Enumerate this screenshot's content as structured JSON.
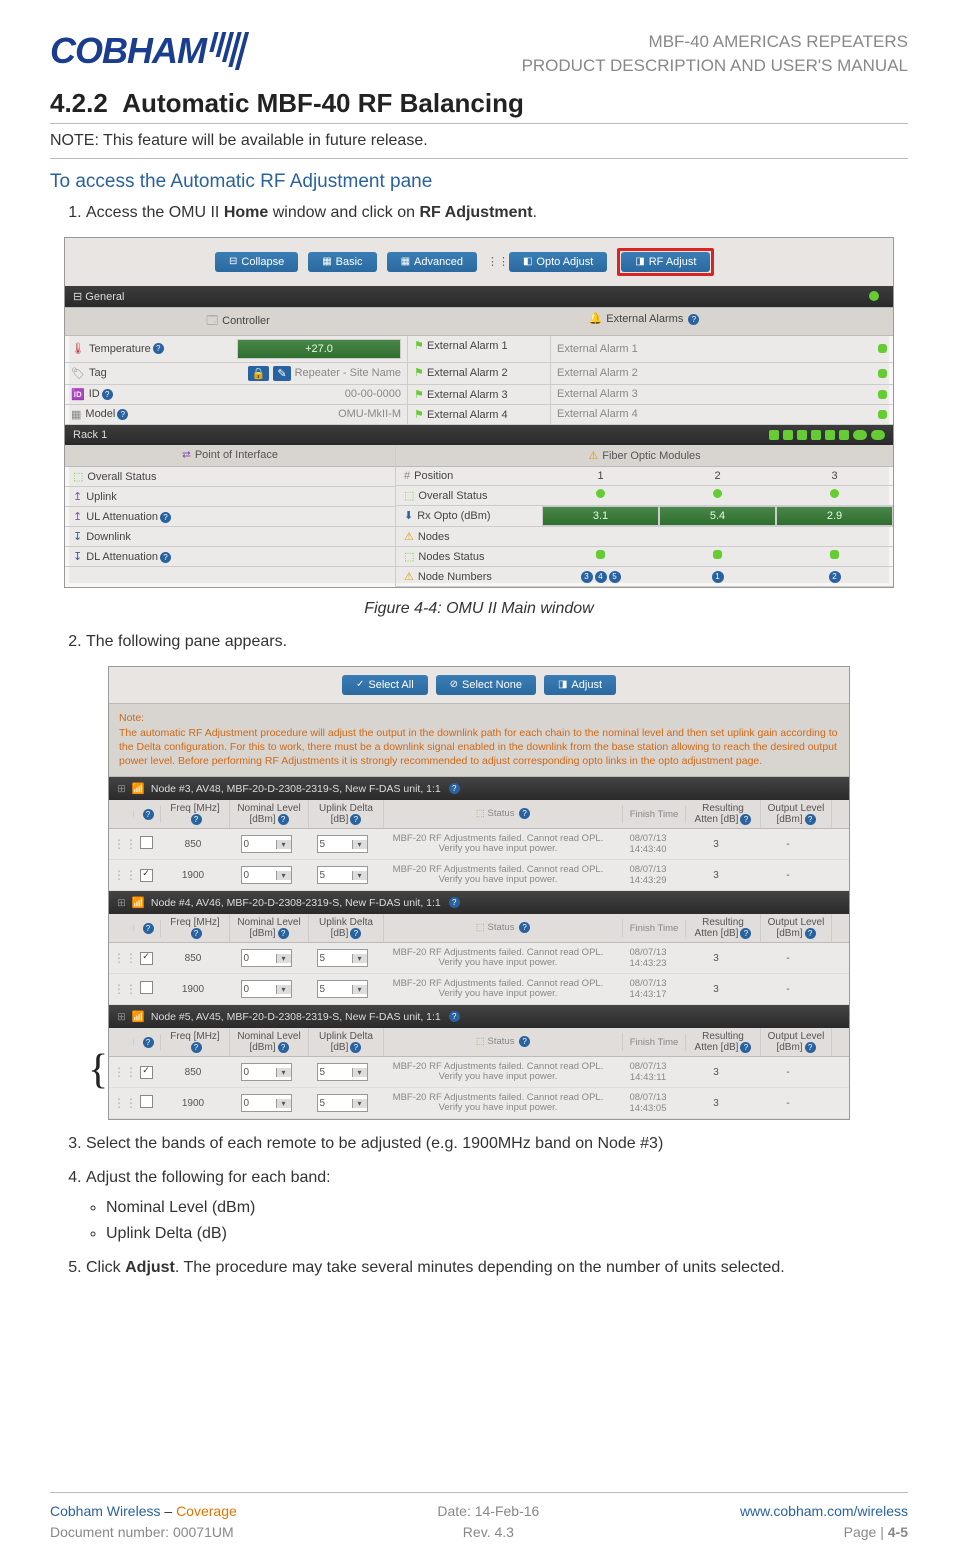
{
  "header": {
    "logo_text": "COBHAM",
    "title_line1": "MBF-40 AMERICAS REPEATERS",
    "title_line2": "PRODUCT DESCRIPTION AND USER'S MANUAL"
  },
  "section": {
    "number": "4.2.2",
    "title": "Automatic MBF-40 RF Balancing",
    "note": "NOTE: This feature will be available in future release.",
    "subtitle": "To access the Automatic RF Adjustment pane",
    "step1_pre": "Access the OMU II ",
    "step1_home": "Home",
    "step1_mid": " window and click on ",
    "step1_rf": "RF Adjustment",
    "step1_end": ".",
    "caption1": "Figure 4-4: OMU II Main window",
    "step2": "The following pane appears.",
    "step3": "Select the bands of each remote to be adjusted (e.g. 1900MHz band on Node #3)",
    "step4": "Adjust the following for each band:",
    "bullets": {
      "b1": "Nominal Level (dBm)",
      "b2": "Uplink Delta (dB)"
    },
    "step5_pre": "Click ",
    "step5_adj": "Adjust",
    "step5_post": ". The procedure may take several minutes depending on the number of units selected."
  },
  "screenshot1": {
    "topbar": {
      "collapse": "Collapse",
      "basic": "Basic",
      "advanced": "Advanced",
      "opto": "Opto Adjust",
      "rf": "RF Adjust"
    },
    "general": {
      "title": "General",
      "controller_header": "Controller",
      "ext_alarms_header": "External Alarms",
      "rows": {
        "temp_label": "Temperature",
        "temp_val": "+27.0",
        "tag_label": "Tag",
        "tag_val": "Repeater - Site Name",
        "id_label": "ID",
        "id_val": "00-00-0000",
        "model_label": "Model",
        "model_val": "OMU-MkII-M",
        "ea1_label": "External Alarm 1",
        "ea1_val": "External Alarm 1",
        "ea2_label": "External Alarm 2",
        "ea2_val": "External Alarm 2",
        "ea3_label": "External Alarm 3",
        "ea3_val": "External Alarm 3",
        "ea4_label": "External Alarm 4",
        "ea4_val": "External Alarm 4"
      }
    },
    "rack": {
      "title": "Rack 1",
      "poi_header": "Point of Interface",
      "fom_header": "Fiber Optic Modules",
      "left": {
        "overall": "Overall Status",
        "uplink": "Uplink",
        "ulatt": "UL Attenuation",
        "downlink": "Downlink",
        "dlatt": "DL Attenuation"
      },
      "right": {
        "position": "Position",
        "p1": "1",
        "p2": "2",
        "p3": "3",
        "overall": "Overall Status",
        "rxopto": "Rx Opto (dBm)",
        "r1": "3.1",
        "r2": "5.4",
        "r3": "2.9",
        "nodes": "Nodes",
        "nodes_status": "Nodes Status",
        "node_numbers": "Node Numbers",
        "n1": "3",
        "n1b": "4",
        "n1c": "5",
        "n2": "1",
        "n3": "2"
      }
    }
  },
  "screenshot2": {
    "topbar": {
      "select_all": "Select All",
      "select_none": "Select None",
      "adjust": "Adjust"
    },
    "note_title": "Note:",
    "note_body": "The automatic RF Adjustment procedure will adjust the output in the downlink path for each chain to the nominal level and then set uplink gain according to the Delta configuration. For this to work, there must be a downlink signal enabled in the downlink from the base station allowing to reach the desired output power level. Before performing RF Adjustments it is strongly recommended to adjust corresponding opto links in the opto adjustment page.",
    "adj_headers": {
      "freq": "Freq [MHz]",
      "nominal": "Nominal Level [dBm]",
      "uplink": "Uplink Delta [dB]",
      "status": "Status",
      "finish": "Finish Time",
      "atten": "Resulting Atten [dB]",
      "output": "Output Level [dBm]"
    },
    "nodes": [
      {
        "title": "Node #3, AV48, MBF-20-D-2308-2319-S, New F-DAS unit, 1:1",
        "rows": [
          {
            "checked": false,
            "freq": "850",
            "nominal": "0",
            "uplink": "5",
            "status": "MBF-20 RF Adjustments failed. Cannot read OPL. Verify you have input power.",
            "finish": "08/07/13 14:43:40",
            "atten": "3",
            "output": "-"
          },
          {
            "checked": true,
            "freq": "1900",
            "nominal": "0",
            "uplink": "5",
            "status": "MBF-20 RF Adjustments failed. Cannot read OPL. Verify you have input power.",
            "finish": "08/07/13 14:43:29",
            "atten": "3",
            "output": "-"
          }
        ]
      },
      {
        "title": "Node #4, AV46, MBF-20-D-2308-2319-S, New F-DAS unit, 1:1",
        "rows": [
          {
            "checked": true,
            "freq": "850",
            "nominal": "0",
            "uplink": "5",
            "status": "MBF-20 RF Adjustments failed. Cannot read OPL. Verify you have input power.",
            "finish": "08/07/13 14:43:23",
            "atten": "3",
            "output": "-"
          },
          {
            "checked": false,
            "freq": "1900",
            "nominal": "0",
            "uplink": "5",
            "status": "MBF-20 RF Adjustments failed. Cannot read OPL. Verify you have input power.",
            "finish": "08/07/13 14:43:17",
            "atten": "3",
            "output": "-"
          }
        ]
      },
      {
        "title": "Node #5, AV45, MBF-20-D-2308-2319-S, New F-DAS unit, 1:1",
        "rows": [
          {
            "checked": true,
            "freq": "850",
            "nominal": "0",
            "uplink": "5",
            "status": "MBF-20 RF Adjustments failed. Cannot read OPL. Verify you have input power.",
            "finish": "08/07/13 14:43:11",
            "atten": "3",
            "output": "-"
          },
          {
            "checked": false,
            "freq": "1900",
            "nominal": "0",
            "uplink": "5",
            "status": "MBF-20 RF Adjustments failed. Cannot read OPL. Verify you have input power.",
            "finish": "08/07/13 14:43:05",
            "atten": "3",
            "output": "-"
          }
        ]
      }
    ]
  },
  "footer": {
    "brand": "Cobham Wireless",
    "sep": " – ",
    "coverage": "Coverage",
    "doc_label": "Document number: ",
    "doc_num": "00071UM",
    "date_label": "Date: ",
    "date": "14-Feb-16",
    "rev_label": "Rev. ",
    "rev": "4.3",
    "url": "www.cobham.com/wireless",
    "page_label": "Page | ",
    "page": "4-5"
  }
}
